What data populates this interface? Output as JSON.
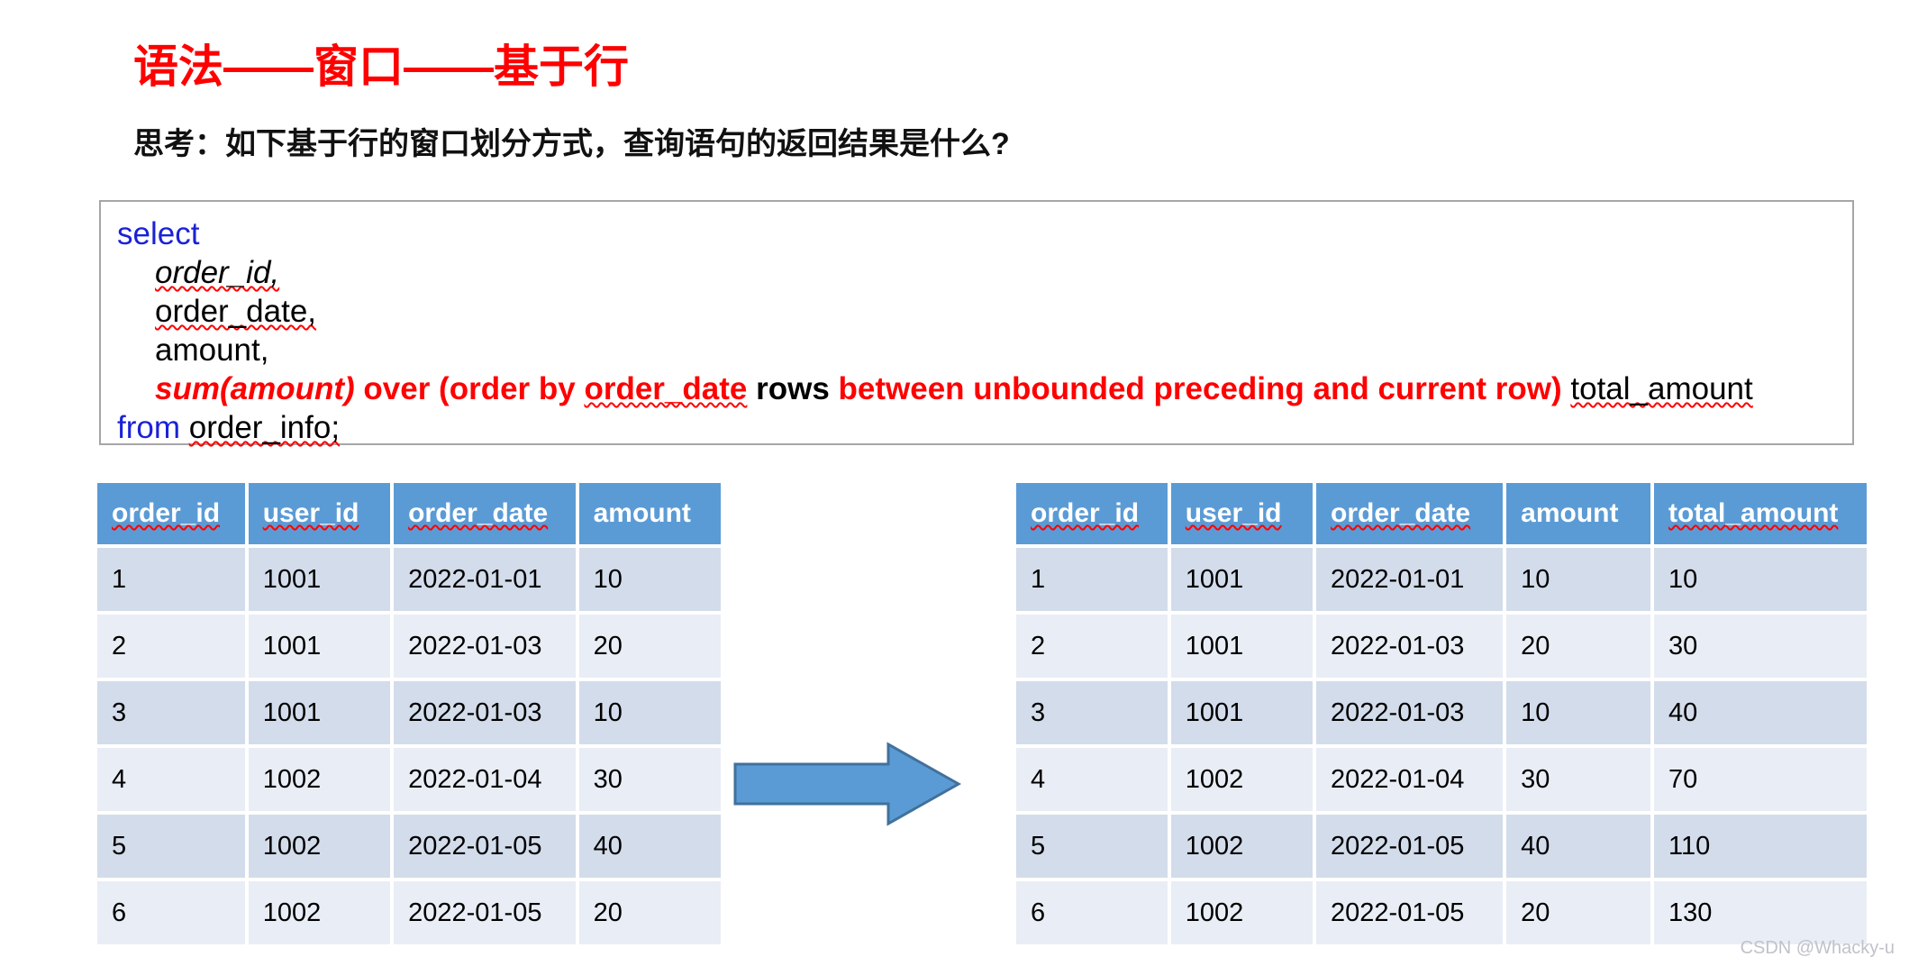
{
  "slide": {
    "title": "语法——窗口——基于行",
    "subtitle": "思考：如下基于行的窗口划分方式，查询语句的返回结果是什么?",
    "watermark": "CSDN @Whacky-u"
  },
  "colors": {
    "title_red": "#FF0000",
    "keyword_blue": "#1A22D6",
    "header_blue": "#5B9BD5",
    "row_dark": "#D3DCEA",
    "row_light": "#E9EDF5",
    "arrow_fill": "#5B9BD5",
    "arrow_stroke": "#41719C",
    "box_border": "#A6A6A6"
  },
  "code": {
    "line1": "select",
    "line2": "order_id,",
    "line3": "order_date,",
    "line4": "amount,",
    "line5_a": "sum(amount)",
    "line5_b": " over (order by ",
    "line5_c": "order_date",
    "line5_d": "rows",
    "line5_e": "between unbounded preceding and current row)",
    "line5_f": "total_amount",
    "line6_a": "from",
    "line6_b": "order_info;"
  },
  "table_left": {
    "columns": [
      "order_id",
      "user_id",
      "order_date",
      "amount"
    ],
    "rows": [
      [
        "1",
        "1001",
        "2022-01-01",
        "10"
      ],
      [
        "2",
        "1001",
        "2022-01-03",
        "20"
      ],
      [
        "3",
        "1001",
        "2022-01-03",
        "10"
      ],
      [
        "4",
        "1002",
        "2022-01-04",
        "30"
      ],
      [
        "5",
        "1002",
        "2022-01-05",
        "40"
      ],
      [
        "6",
        "1002",
        "2022-01-05",
        "20"
      ]
    ]
  },
  "table_right": {
    "columns": [
      "order_id",
      "user_id",
      "order_date",
      "amount",
      "total_amount"
    ],
    "rows": [
      [
        "1",
        "1001",
        "2022-01-01",
        "10",
        "10"
      ],
      [
        "2",
        "1001",
        "2022-01-03",
        "20",
        "30"
      ],
      [
        "3",
        "1001",
        "2022-01-03",
        "10",
        "40"
      ],
      [
        "4",
        "1002",
        "2022-01-04",
        "30",
        "70"
      ],
      [
        "5",
        "1002",
        "2022-01-05",
        "40",
        "110"
      ],
      [
        "6",
        "1002",
        "2022-01-05",
        "20",
        "130"
      ]
    ]
  },
  "arrow": {
    "label": "transform-arrow",
    "direction": "right"
  }
}
